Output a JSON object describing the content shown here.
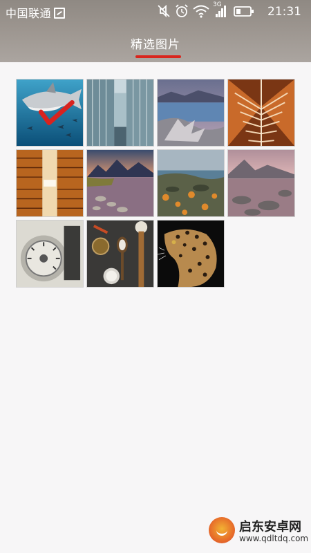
{
  "status_bar": {
    "carrier": "中国联通",
    "network": "3G",
    "time": "21:31",
    "icons": [
      "sim-icon",
      "mute-icon",
      "alarm-icon",
      "wifi-icon",
      "signal-icon",
      "battery-icon"
    ]
  },
  "header": {
    "title": "精选图片",
    "accent_color": "#d9251d"
  },
  "gallery": {
    "columns": 4,
    "selected_index": 0,
    "images": [
      {
        "subject": "shark-photo",
        "selected": true
      },
      {
        "subject": "glass-building-photo",
        "selected": false
      },
      {
        "subject": "driftwood-lake-photo",
        "selected": false
      },
      {
        "subject": "architecture-symmetry-photo",
        "selected": false
      },
      {
        "subject": "skyscraper-reflection-photo",
        "selected": false
      },
      {
        "subject": "mountain-lake-sunset-photo",
        "selected": false
      },
      {
        "subject": "rocky-coast-photo",
        "selected": false
      },
      {
        "subject": "lake-stones-photo",
        "selected": false
      },
      {
        "subject": "camera-dial-photo",
        "selected": false
      },
      {
        "subject": "spices-spoons-photo",
        "selected": false
      },
      {
        "subject": "leopard-photo",
        "selected": false
      }
    ]
  },
  "watermark": {
    "name": "启东安卓网",
    "url": "www.qdltdq.com"
  }
}
